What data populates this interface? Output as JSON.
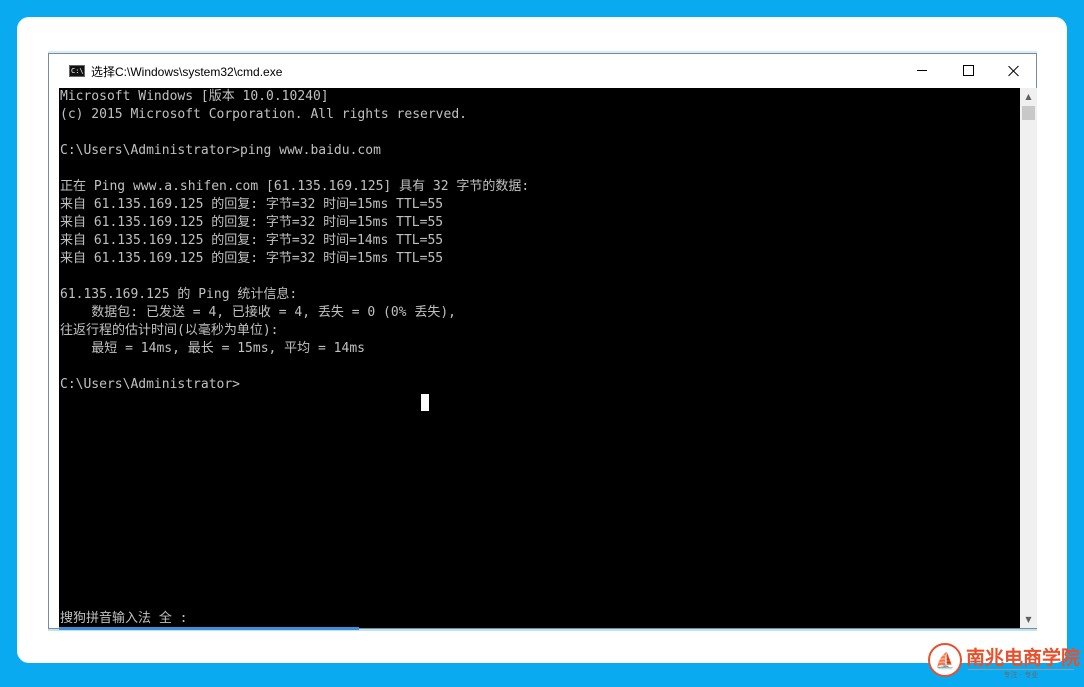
{
  "window": {
    "title": "选择C:\\Windows\\system32\\cmd.exe",
    "icon": "cmd-icon",
    "controls": {
      "minimize": "minimize-icon",
      "maximize": "maximize-icon",
      "close": "close-icon"
    }
  },
  "console": {
    "text": "Microsoft Windows [版本 10.0.10240]\n(c) 2015 Microsoft Corporation. All rights reserved.\n\nC:\\Users\\Administrator>ping www.baidu.com\n\n正在 Ping www.a.shifen.com [61.135.169.125] 具有 32 字节的数据:\n来自 61.135.169.125 的回复: 字节=32 时间=15ms TTL=55\n来自 61.135.169.125 的回复: 字节=32 时间=15ms TTL=55\n来自 61.135.169.125 的回复: 字节=32 时间=14ms TTL=55\n来自 61.135.169.125 的回复: 字节=32 时间=15ms TTL=55\n\n61.135.169.125 的 Ping 统计信息:\n    数据包: 已发送 = 4, 已接收 = 4, 丢失 = 0 (0% 丢失),\n往返行程的估计时间(以毫秒为单位):\n    最短 = 14ms, 最长 = 15ms, 平均 = 14ms\n\nC:\\Users\\Administrator>",
    "ime_status": "搜狗拼音输入法 全 :"
  },
  "watermark": {
    "name": "南兆电商学院",
    "tagline": "专注 · 专业"
  },
  "colors": {
    "background": "#0aaaf0",
    "console_bg": "#000000",
    "console_fg": "#c0c0c0",
    "logo": "#e8502b"
  }
}
